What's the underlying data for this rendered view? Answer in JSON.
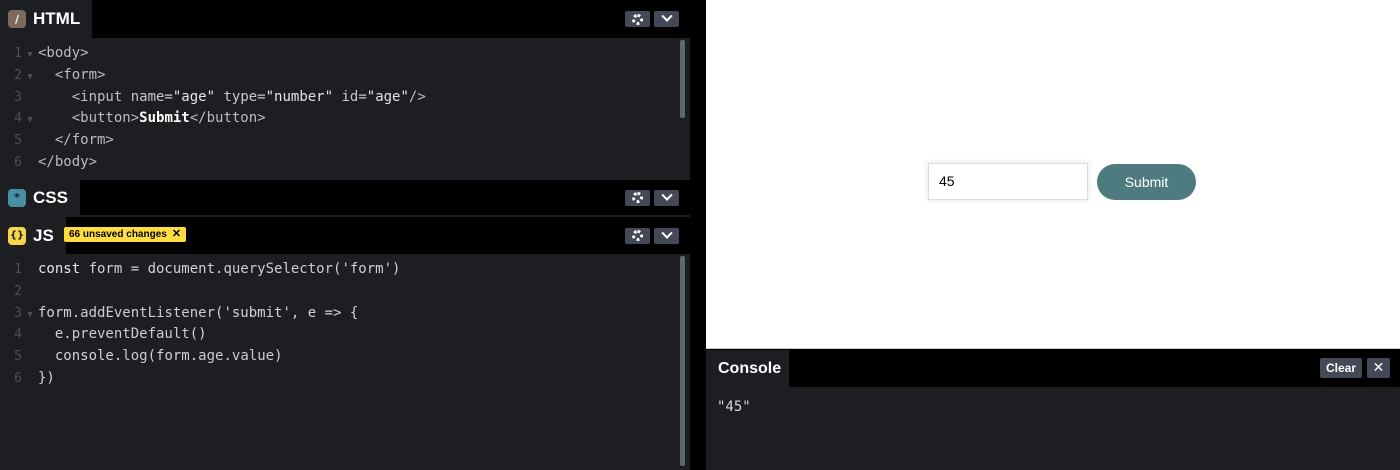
{
  "html_panel": {
    "tab_label": "HTML",
    "tab_icon": "slash-icon",
    "icon_color": "#7c6a5c",
    "lines": [
      {
        "num": "1",
        "fold": true,
        "segments": [
          {
            "t": "<body>",
            "c": "t-tag"
          }
        ]
      },
      {
        "num": "2",
        "fold": true,
        "segments": [
          {
            "t": "  <form>",
            "c": "t-tag"
          }
        ]
      },
      {
        "num": "3",
        "fold": false,
        "segments": [
          {
            "t": "    <input ",
            "c": "t-tag"
          },
          {
            "t": "name=",
            "c": "t-attr"
          },
          {
            "t": "\"age\"",
            "c": "t-str"
          },
          {
            "t": " type=",
            "c": "t-attr"
          },
          {
            "t": "\"number\"",
            "c": "t-str"
          },
          {
            "t": " id=",
            "c": "t-attr"
          },
          {
            "t": "\"age\"",
            "c": "t-str"
          },
          {
            "t": "/>",
            "c": "t-tag"
          }
        ]
      },
      {
        "num": "4",
        "fold": true,
        "segments": [
          {
            "t": "    <button>",
            "c": "t-tag"
          },
          {
            "t": "Submit",
            "c": "t-bold"
          },
          {
            "t": "</button>",
            "c": "t-tag"
          }
        ]
      },
      {
        "num": "5",
        "fold": false,
        "segments": [
          {
            "t": "  </form>",
            "c": "t-tag"
          }
        ]
      },
      {
        "num": "6",
        "fold": false,
        "segments": [
          {
            "t": "</body>",
            "c": "t-tag"
          }
        ]
      }
    ]
  },
  "css_panel": {
    "tab_label": "CSS",
    "tab_icon": "asterisk-icon",
    "icon_color": "#4a90a4"
  },
  "js_panel": {
    "tab_label": "JS",
    "tab_icon": "braces-icon",
    "icon_color": "#f7d74a",
    "badge_text": "66 unsaved changes",
    "lines": [
      {
        "num": "1",
        "fold": false,
        "segments": [
          {
            "t": "const ",
            "c": "t-kw"
          },
          {
            "t": "form = document.",
            "c": "code"
          },
          {
            "t": "querySelector",
            "c": "t-fn"
          },
          {
            "t": "('form')",
            "c": "code"
          }
        ]
      },
      {
        "num": "2",
        "fold": false,
        "segments": [
          {
            "t": "",
            "c": "code"
          }
        ]
      },
      {
        "num": "3",
        "fold": true,
        "segments": [
          {
            "t": "form.",
            "c": "code"
          },
          {
            "t": "addEventListener",
            "c": "t-fn"
          },
          {
            "t": "('submit', e => {",
            "c": "code"
          }
        ]
      },
      {
        "num": "4",
        "fold": false,
        "segments": [
          {
            "t": "  e.",
            "c": "code"
          },
          {
            "t": "preventDefault",
            "c": "t-fn"
          },
          {
            "t": "()",
            "c": "code"
          }
        ]
      },
      {
        "num": "5",
        "fold": false,
        "segments": [
          {
            "t": "  console.",
            "c": "code"
          },
          {
            "t": "log",
            "c": "t-fn"
          },
          {
            "t": "(form.",
            "c": "code"
          },
          {
            "t": "age",
            "c": "t-fn"
          },
          {
            "t": ".",
            "c": "code"
          },
          {
            "t": "value",
            "c": "t-fn"
          },
          {
            "t": ")",
            "c": "code"
          }
        ]
      },
      {
        "num": "6",
        "fold": false,
        "segments": [
          {
            "t": "})",
            "c": "code"
          }
        ]
      }
    ]
  },
  "preview": {
    "input_value": "45",
    "button_label": "Submit",
    "button_color": "#4e7b80"
  },
  "console": {
    "tab_label": "Console",
    "clear_label": "Clear",
    "close_glyph": "✕",
    "output": "\"45\""
  }
}
